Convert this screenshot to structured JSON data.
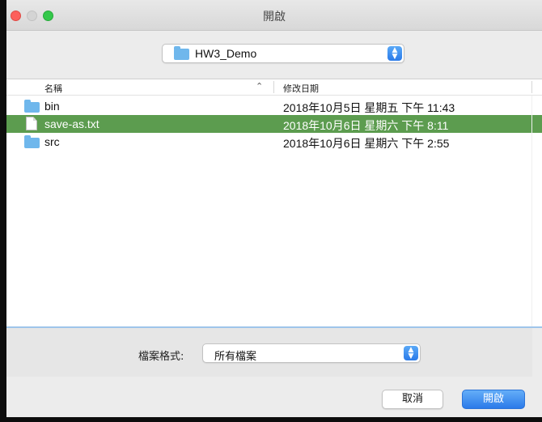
{
  "window": {
    "title": "開啟"
  },
  "location": {
    "folder_name": "HW3_Demo",
    "stepper_up": "▲",
    "stepper_down": "▼"
  },
  "file_list": {
    "columns": {
      "name": "名稱",
      "date_modified": "修改日期"
    },
    "sort_indicator": "⌃",
    "rows": [
      {
        "type": "folder",
        "name": "bin",
        "date": "2018年10月5日 星期五 下午 11:43",
        "selected": false
      },
      {
        "type": "file",
        "name": "save-as.txt",
        "date": "2018年10月6日 星期六 下午 8:11",
        "selected": true
      },
      {
        "type": "folder",
        "name": "src",
        "date": "2018年10月6日 星期六 下午 2:55",
        "selected": false
      }
    ]
  },
  "format": {
    "label": "檔案格式:",
    "value": "所有檔案"
  },
  "buttons": {
    "cancel": "取消",
    "open": "開啟"
  },
  "colors": {
    "selection": "#5c9c4f",
    "accent_blue": "#2b7ae9",
    "folder_icon": "#6fb7ec"
  }
}
